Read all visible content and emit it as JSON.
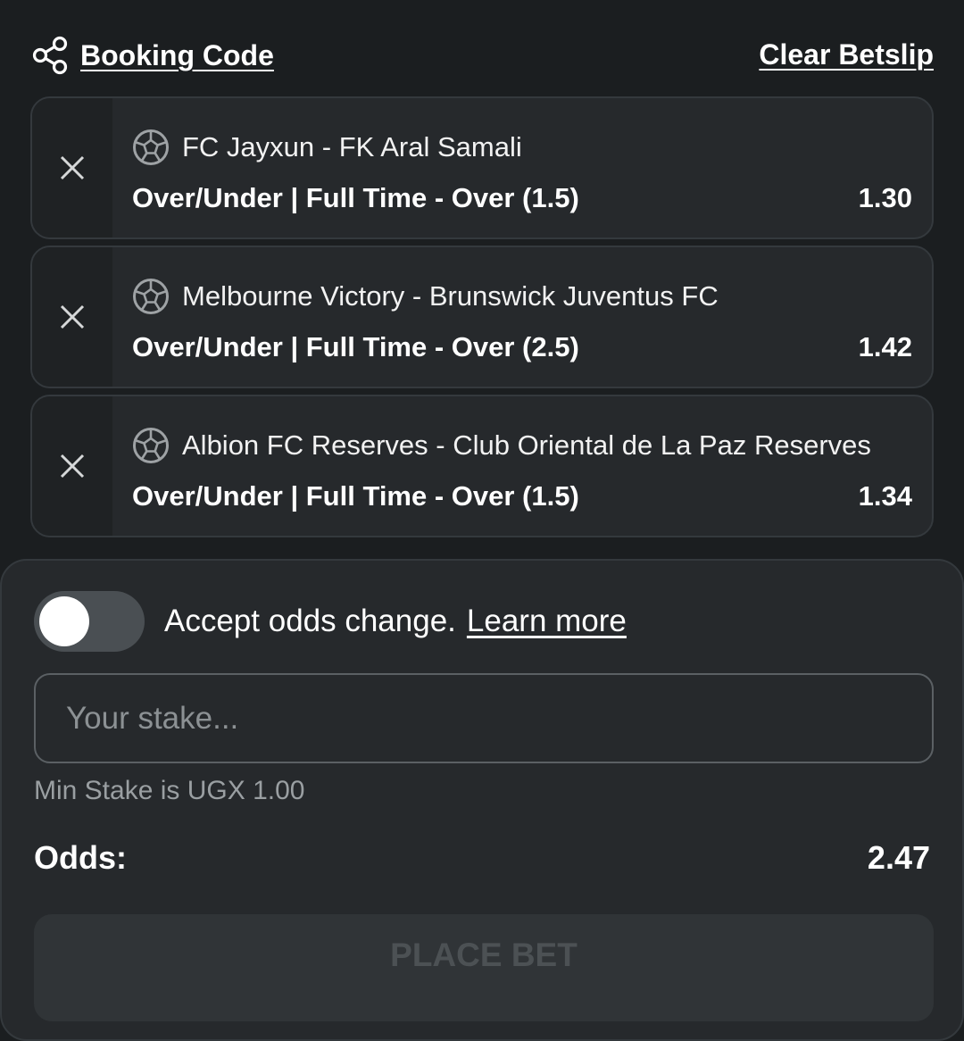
{
  "header": {
    "booking_code_label": "Booking Code",
    "clear_betslip_label": "Clear Betslip"
  },
  "bets": [
    {
      "match": "FC Jayxun - FK Aral Samali",
      "market": "Over/Under | Full Time - Over (1.5)",
      "odds": "1.30"
    },
    {
      "match": "Melbourne Victory - Brunswick Juventus FC",
      "market": "Over/Under | Full Time - Over (2.5)",
      "odds": "1.42"
    },
    {
      "match": "Albion FC Reserves - Club Oriental de La Paz Reserves",
      "market": "Over/Under | Full Time - Over (1.5)",
      "odds": "1.34"
    }
  ],
  "panel": {
    "accept_odds_text": "Accept odds change.",
    "learn_more_label": "Learn more",
    "accept_odds_enabled": false,
    "stake_placeholder": "Your stake...",
    "stake_value": "",
    "min_stake_text": "Min Stake is UGX 1.00",
    "odds_label": "Odds:",
    "total_odds": "2.47",
    "place_bet_label": "PLACE BET"
  },
  "icons": {
    "share": "share-icon",
    "remove": "close-icon",
    "sport": "soccer-ball-icon"
  },
  "colors": {
    "background": "#1b1e20",
    "card": "#26292c",
    "text": "#ffffff",
    "muted_text": "#9a9fa2",
    "toggle_off": "#4a4f53",
    "button_disabled": "#303437"
  }
}
